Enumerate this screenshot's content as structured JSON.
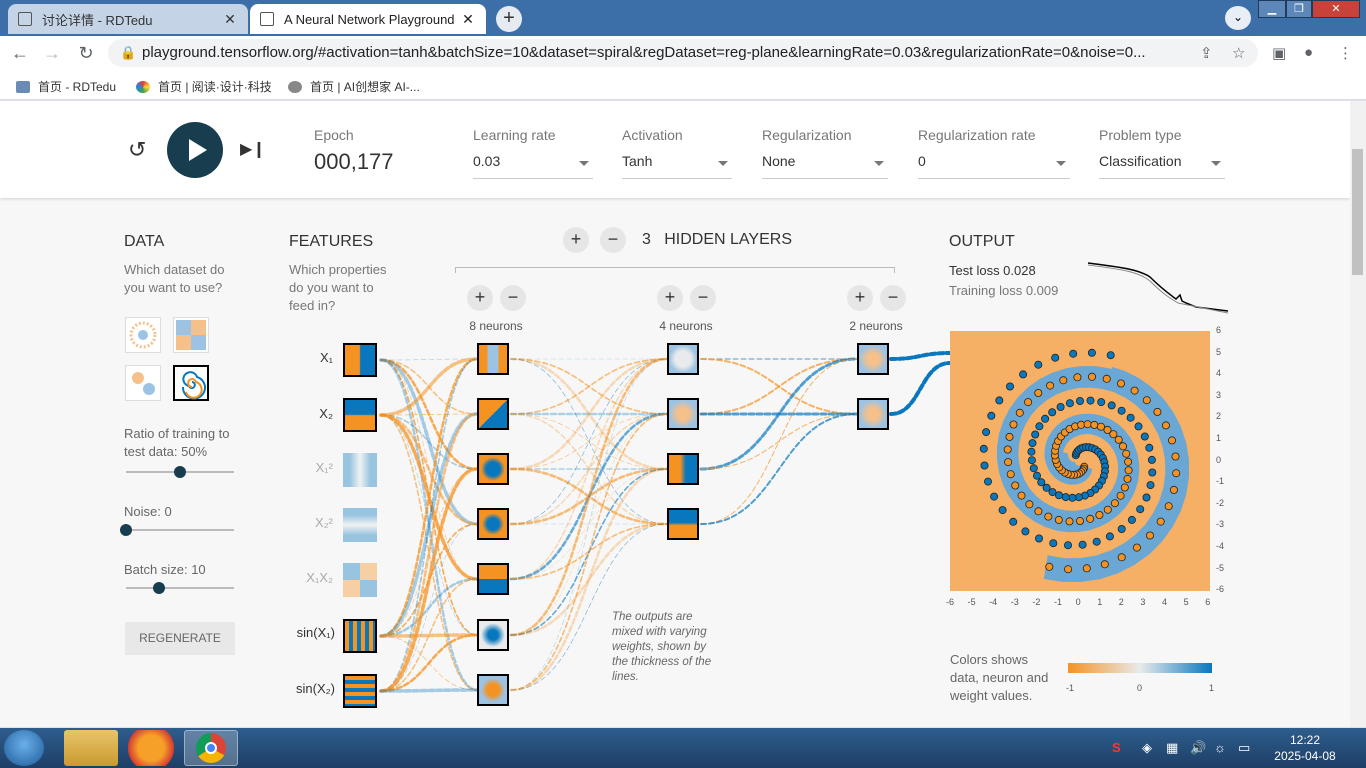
{
  "browser": {
    "tabs": [
      {
        "title": "讨论详情 - RDTedu",
        "active": false
      },
      {
        "title": "A Neural Network Playground",
        "active": true
      }
    ],
    "url": "playground.tensorflow.org/#activation=tanh&batchSize=10&dataset=spiral&regDataset=reg-plane&learningRate=0.03&regularizationRate=0&noise=0...",
    "bookmarks": [
      "首页 - RDTedu",
      "首页 | 阅读·设计·科技",
      "首页 | AI创想家 AI-..."
    ]
  },
  "header": {
    "epoch_label": "Epoch",
    "epoch_value": "000,177",
    "controls": [
      {
        "label": "Learning rate",
        "value": "0.03"
      },
      {
        "label": "Activation",
        "value": "Tanh"
      },
      {
        "label": "Regularization",
        "value": "None"
      },
      {
        "label": "Regularization rate",
        "value": "0"
      },
      {
        "label": "Problem type",
        "value": "Classification"
      }
    ]
  },
  "data_panel": {
    "title": "DATA",
    "subtitle": "Which dataset do you want to use?",
    "ratio_label": "Ratio of training to test data:  50%",
    "ratio_value": 0.5,
    "noise_label": "Noise:  0",
    "noise_value": 0,
    "batch_label": "Batch size:  10",
    "batch_value": 10,
    "regenerate": "REGENERATE"
  },
  "features_panel": {
    "title": "FEATURES",
    "subtitle": "Which properties do you want to feed in?",
    "features": [
      {
        "label": "X₁",
        "active": true
      },
      {
        "label": "X₂",
        "active": true
      },
      {
        "label": "X₁²",
        "active": false
      },
      {
        "label": "X₂²",
        "active": false
      },
      {
        "label": "X₁X₂",
        "active": false
      },
      {
        "label": "sin(X₁)",
        "active": true
      },
      {
        "label": "sin(X₂)",
        "active": true
      }
    ]
  },
  "hidden": {
    "count": "3",
    "title": "HIDDEN LAYERS",
    "layers": [
      {
        "label": "8 neurons"
      },
      {
        "label": "4 neurons"
      },
      {
        "label": "2 neurons"
      }
    ],
    "note": "The outputs are mixed with varying weights, shown by the thickness of the lines."
  },
  "output": {
    "title": "OUTPUT",
    "test_loss": "Test loss 0.028",
    "training_loss": "Training loss 0.009",
    "axis_ticks": [
      "-6",
      "-5",
      "-4",
      "-3",
      "-2",
      "-1",
      "0",
      "1",
      "2",
      "3",
      "4",
      "5",
      "6"
    ],
    "legend_text": "Colors shows data, neuron and weight values.",
    "legend_min": "-1",
    "legend_mid": "0",
    "legend_max": "1"
  },
  "taskbar": {
    "time": "12:22",
    "date": "2025-04-08"
  },
  "colors": {
    "orange": "#f59322",
    "blue": "#0877bd",
    "dark": "#183d4e"
  }
}
